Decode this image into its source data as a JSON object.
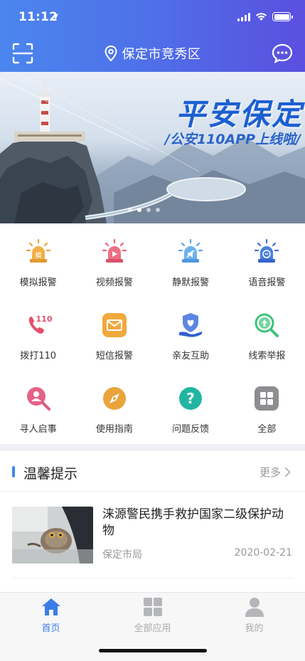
{
  "status_bar": {
    "time": "11:12"
  },
  "header": {
    "location": "保定市竞秀区"
  },
  "banner": {
    "title": "平安保定",
    "subtitle": "/公安110APP上线啦/"
  },
  "grid": [
    {
      "label": "模拟报警",
      "icon": "mock-alarm-icon",
      "color": "#e9a23b"
    },
    {
      "label": "视频报警",
      "icon": "video-alarm-icon",
      "color": "#e8607a"
    },
    {
      "label": "静默报警",
      "icon": "silent-alarm-icon",
      "color": "#5aa2e6"
    },
    {
      "label": "语音报警",
      "icon": "voice-alarm-icon",
      "color": "#3f72d6"
    },
    {
      "label": "拨打110",
      "icon": "dial-110-icon",
      "color": "#e2506b"
    },
    {
      "label": "短信报警",
      "icon": "sms-alarm-icon",
      "color": "#f1a93c"
    },
    {
      "label": "亲友互助",
      "icon": "friend-help-icon",
      "color": "#3d6ed8"
    },
    {
      "label": "线索举报",
      "icon": "clue-report-icon",
      "color": "#3ec27a"
    },
    {
      "label": "寻人启事",
      "icon": "missing-person-icon",
      "color": "#e0557a"
    },
    {
      "label": "使用指南",
      "icon": "guide-compass-icon",
      "color": "#e9a13a"
    },
    {
      "label": "问题反馈",
      "icon": "feedback-question-icon",
      "color": "#22b5a2"
    },
    {
      "label": "全部",
      "icon": "all-apps-icon",
      "color": "#8d8d92"
    }
  ],
  "notice": {
    "title": "温馨提示",
    "more": "更多",
    "items": [
      {
        "title": "涞源警民携手救护国家二级保护动物",
        "source": "保定市局",
        "date": "2020-02-21"
      }
    ]
  },
  "tabbar": [
    {
      "label": "首页",
      "icon": "home-icon",
      "active": true
    },
    {
      "label": "全部应用",
      "icon": "all-apps-tab-icon",
      "active": false
    },
    {
      "label": "我的",
      "icon": "profile-icon",
      "active": false
    }
  ],
  "colors": {
    "accent": "#3b7de6",
    "header_start": "#4b86ee",
    "header_end": "#5a4fdf"
  }
}
